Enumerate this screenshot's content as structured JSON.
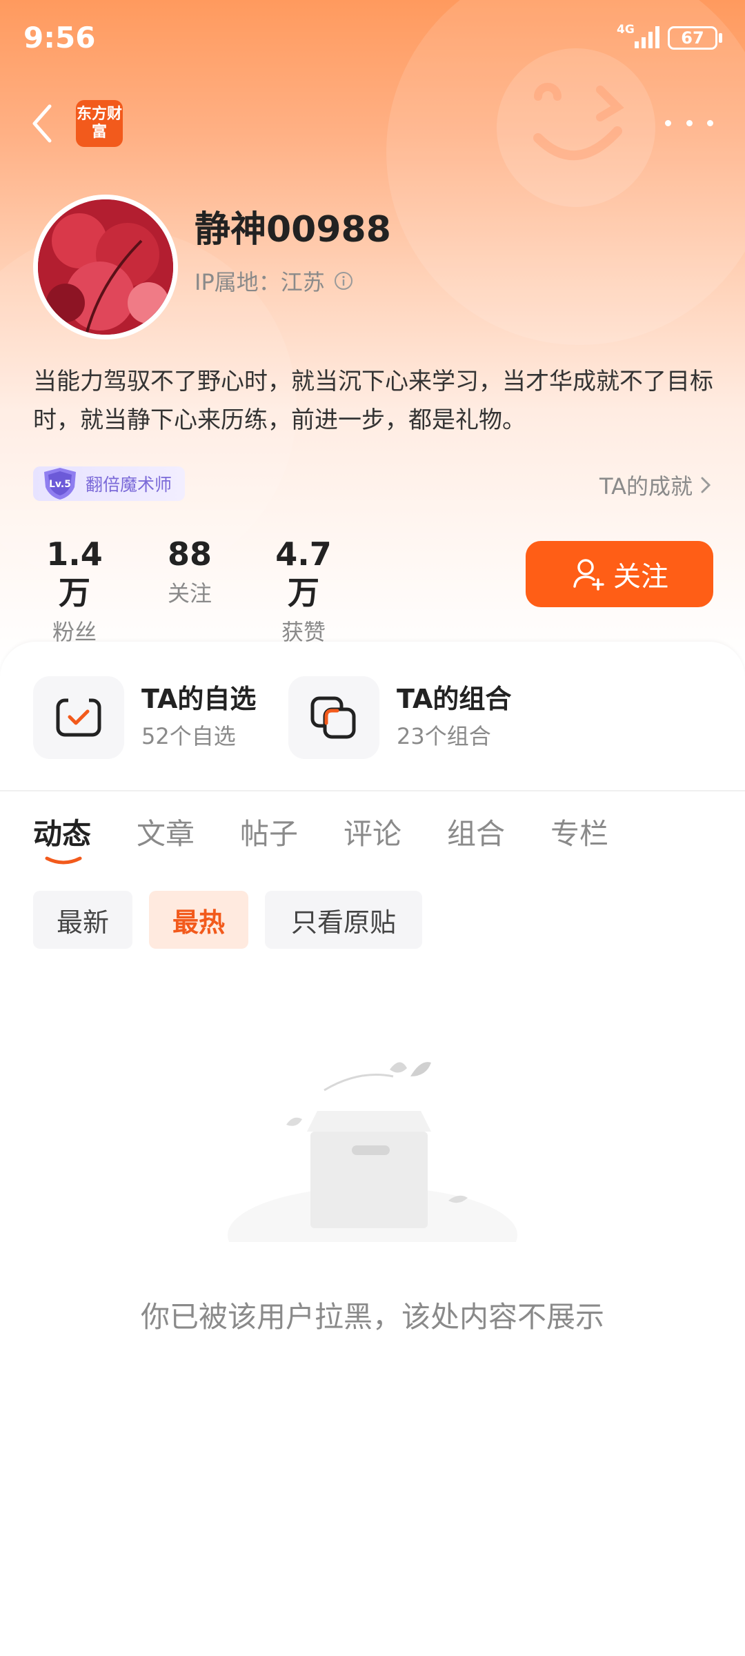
{
  "status_bar": {
    "time": "9:56",
    "network": "4G",
    "battery": "67"
  },
  "header": {
    "logo_text": "东方财富"
  },
  "profile": {
    "username": "静神00988",
    "ip_label": "IP属地：江苏",
    "bio": "当能力驾驭不了野心时，就当沉下心来学习，当才华成就不了目标时，就当静下心来历练，前进一步，都是礼物。",
    "level": "Lv.5",
    "level_title": "翻倍魔术师",
    "achievement_link": "TA的成就"
  },
  "stats": [
    {
      "value": "1.4万",
      "label": "粉丝"
    },
    {
      "value": "88",
      "label": "关注"
    },
    {
      "value": "4.7万",
      "label": "获赞"
    }
  ],
  "follow_button": {
    "label": "关注"
  },
  "cards": [
    {
      "title": "TA的自选",
      "subtitle": "52个自选",
      "icon": "watchlist-icon"
    },
    {
      "title": "TA的组合",
      "subtitle": "23个组合",
      "icon": "portfolio-icon"
    }
  ],
  "tabs": [
    "动态",
    "文章",
    "帖子",
    "评论",
    "组合",
    "专栏"
  ],
  "active_tab": "动态",
  "filters": [
    "最新",
    "最热",
    "只看原贴"
  ],
  "active_filter": "最热",
  "empty_state": {
    "message": "你已被该用户拉黑，该处内容不展示",
    "icon": "empty-box-icon"
  },
  "colors": {
    "accent": "#ff5e16",
    "header_gradient_top": "#ff9a5e",
    "level_badge": "#7b6ad8"
  }
}
